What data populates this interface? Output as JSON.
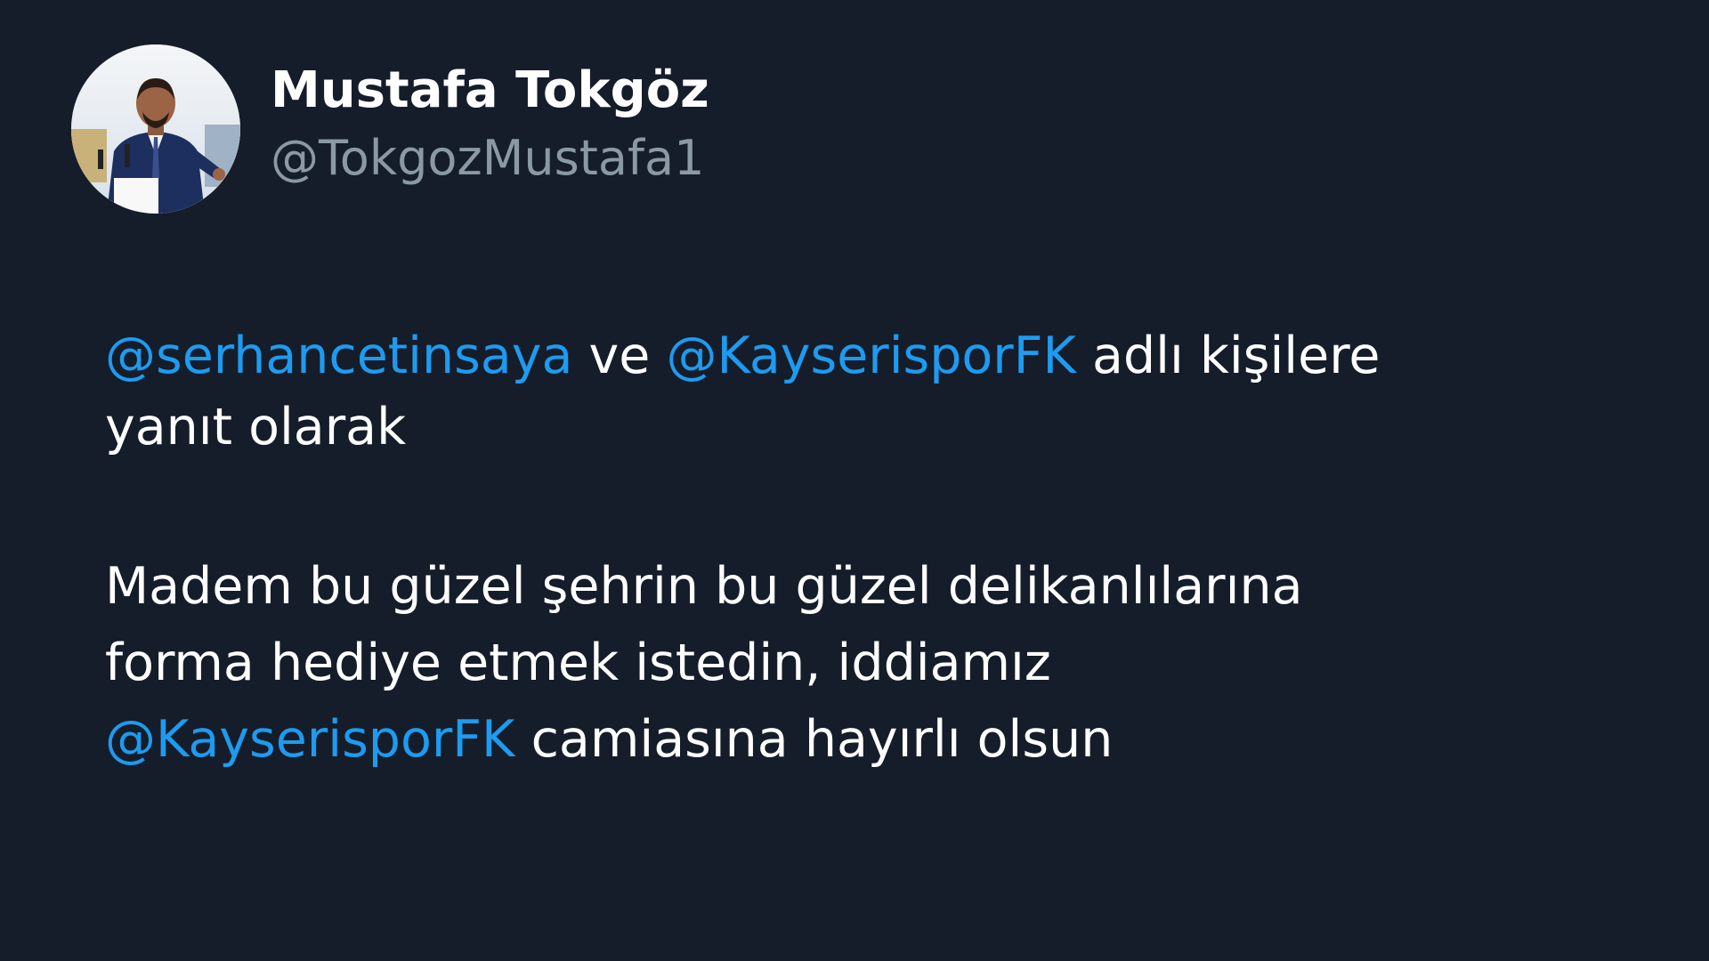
{
  "author": {
    "display_name": "Mustafa Tokgöz",
    "handle": "@TokgozMustafa1",
    "avatar_icon": "profile-photo"
  },
  "reply_context": {
    "mention_1": "@serhancetinsaya",
    "joiner": "ve",
    "mention_2": "@KayserisporFK",
    "suffix_line1": "adlı kişilere",
    "suffix_line2": "yanıt olarak"
  },
  "tweet": {
    "line1": "Madem bu güzel şehrin bu güzel delikanlılarına",
    "line2": "forma hediye etmek istedin, iddiamız",
    "mention": "@KayserisporFK",
    "line3_rest": "camiasına hayırlı olsun"
  },
  "colors": {
    "background": "#151d2a",
    "text": "#ffffff",
    "handle": "#8b98a5",
    "mention": "#1d9bf0"
  }
}
